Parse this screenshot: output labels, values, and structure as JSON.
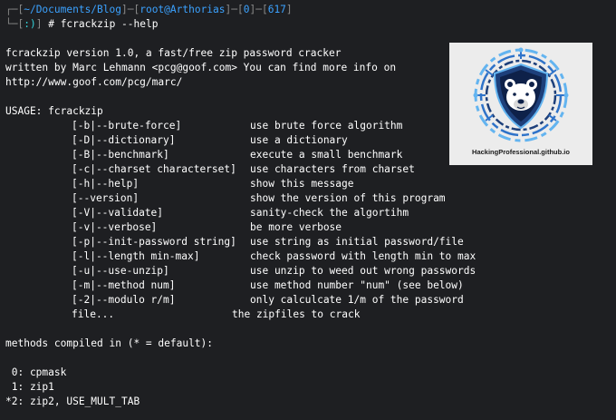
{
  "prompt": {
    "path": "~/Documents/Blog",
    "user_host": "root@Arthorias",
    "code": "0",
    "history": "617",
    "status": ":)",
    "hash": "#",
    "command": "fcrackzip --help"
  },
  "header_lines": [
    "fcrackzip version 1.0, a fast/free zip password cracker",
    "written by Marc Lehmann <pcg@goof.com> You can find more info on",
    "http://www.goof.com/pcg/marc/"
  ],
  "usage_label": "USAGE: fcrackzip",
  "options": [
    {
      "flag": "[-b|--brute-force]",
      "desc": "use brute force algorithm"
    },
    {
      "flag": "[-D|--dictionary]",
      "desc": "use a dictionary"
    },
    {
      "flag": "[-B|--benchmark]",
      "desc": "execute a small benchmark"
    },
    {
      "flag": "[-c|--charset characterset]",
      "desc": "use characters from charset"
    },
    {
      "flag": "[-h|--help]",
      "desc": "show this message"
    },
    {
      "flag": "[--version]",
      "desc": "show the version of this program"
    },
    {
      "flag": "[-V|--validate]",
      "desc": "sanity-check the algortihm"
    },
    {
      "flag": "[-v|--verbose]",
      "desc": "be more verbose"
    },
    {
      "flag": "[-p|--init-password string]",
      "desc": "use string as initial password/file"
    },
    {
      "flag": "[-l|--length min-max]",
      "desc": "check password with length min to max"
    },
    {
      "flag": "[-u|--use-unzip]",
      "desc": "use unzip to weed out wrong passwords"
    },
    {
      "flag": "[-m|--method num]",
      "desc": "use method number \"num\" (see below)"
    },
    {
      "flag": "[-2|--modulo r/m]",
      "desc": "only calculcate 1/m of the password"
    }
  ],
  "file_arg": {
    "flag": "file...",
    "desc": "the zipfiles to crack"
  },
  "methods_label": "methods compiled in (* = default):",
  "methods": [
    " 0: cpmask",
    " 1: zip1",
    "*2: zip2, USE_MULT_TAB"
  ],
  "logo": {
    "caption": "HackingProfessional.github.io",
    "icon": "shield-bear-logo",
    "colors": {
      "dark_blue": "#1d3f7a",
      "mid_blue": "#2f73c9",
      "light_blue": "#63b4f0",
      "navy": "#0e2149"
    }
  },
  "colors": {
    "background": "#1e1f22",
    "text": "#ffffff",
    "prompt_gray": "#8a8a8a",
    "prompt_blue": "#3ba2ff",
    "prompt_cyan": "#33d1d8"
  }
}
